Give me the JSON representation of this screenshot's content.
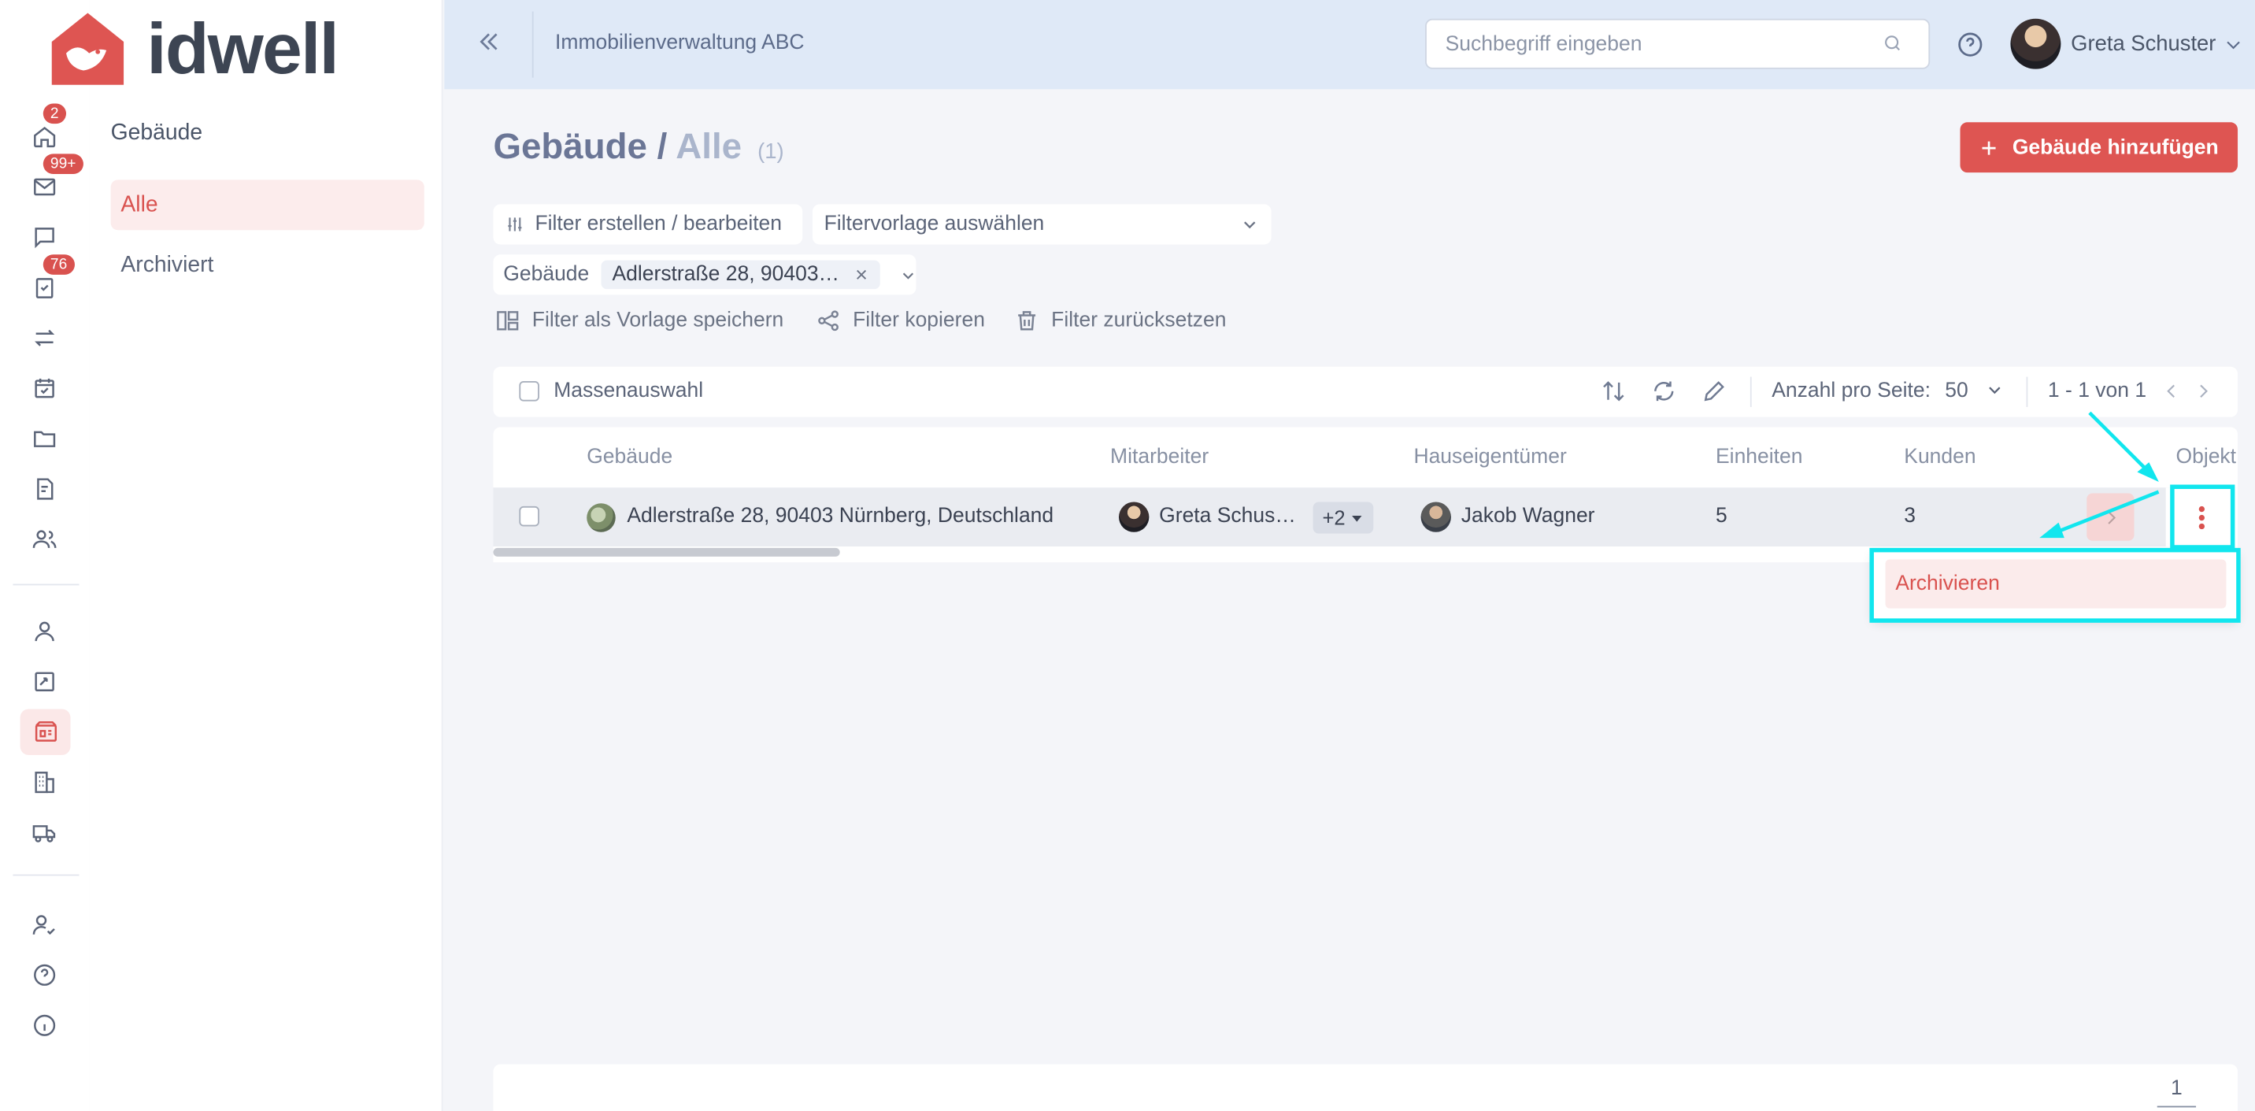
{
  "app": {
    "logo_text": "idwell",
    "brand_color": "#de5552",
    "accent_highlight": "#11e6ee"
  },
  "rail": {
    "badges": {
      "home": "2",
      "mail": "99+",
      "tasks": "76"
    },
    "icons": [
      "home-icon",
      "mail-icon",
      "chat-icon",
      "tasks-icon",
      "transfer-icon",
      "calendar-icon",
      "folder-icon",
      "document-icon",
      "users-icon",
      "person-icon",
      "contract-icon",
      "building-card-icon",
      "buildings-icon",
      "truck-icon",
      "user-check-icon",
      "help-icon",
      "info-icon"
    ],
    "active": "building-card-icon"
  },
  "sidebar": {
    "title": "Gebäude",
    "items": [
      {
        "label": "Alle",
        "active": true
      },
      {
        "label": "Archiviert",
        "active": false
      }
    ]
  },
  "header": {
    "org_name": "Immobilienverwaltung ABC",
    "search_placeholder": "Suchbegriff eingeben",
    "user_name": "Greta Schuster"
  },
  "page": {
    "title": "Gebäude",
    "separator": "/",
    "subtitle": "Alle",
    "count": "(1)",
    "add_button": "Gebäude hinzufügen"
  },
  "filters": {
    "edit_label": "Filter erstellen / bearbeiten",
    "template_select": "Filtervorlage auswählen",
    "active_filter_label": "Gebäude",
    "active_filter_value": "Adlerstraße 28, 90403…",
    "save_template": "Filter als Vorlage speichern",
    "copy_filter": "Filter kopieren",
    "reset_filter": "Filter zurücksetzen"
  },
  "toolbar": {
    "bulk_select": "Massenauswahl",
    "per_page_label": "Anzahl pro Seite:",
    "per_page_value": "50",
    "pagination": "1 - 1 von 1"
  },
  "table": {
    "columns": [
      "Gebäude",
      "Mitarbeiter",
      "Hauseigentümer",
      "Einheiten",
      "Kunden",
      "Objekt"
    ],
    "rows": [
      {
        "building": "Adlerstraße 28, 90403 Nürnberg, Deutschland",
        "employee": "Greta Schus…",
        "extra_employees": "+2",
        "owner": "Jakob Wagner",
        "units": "5",
        "customers": "3"
      }
    ]
  },
  "row_menu": {
    "items": [
      "Archivieren"
    ]
  },
  "footer": {
    "page": "1"
  }
}
